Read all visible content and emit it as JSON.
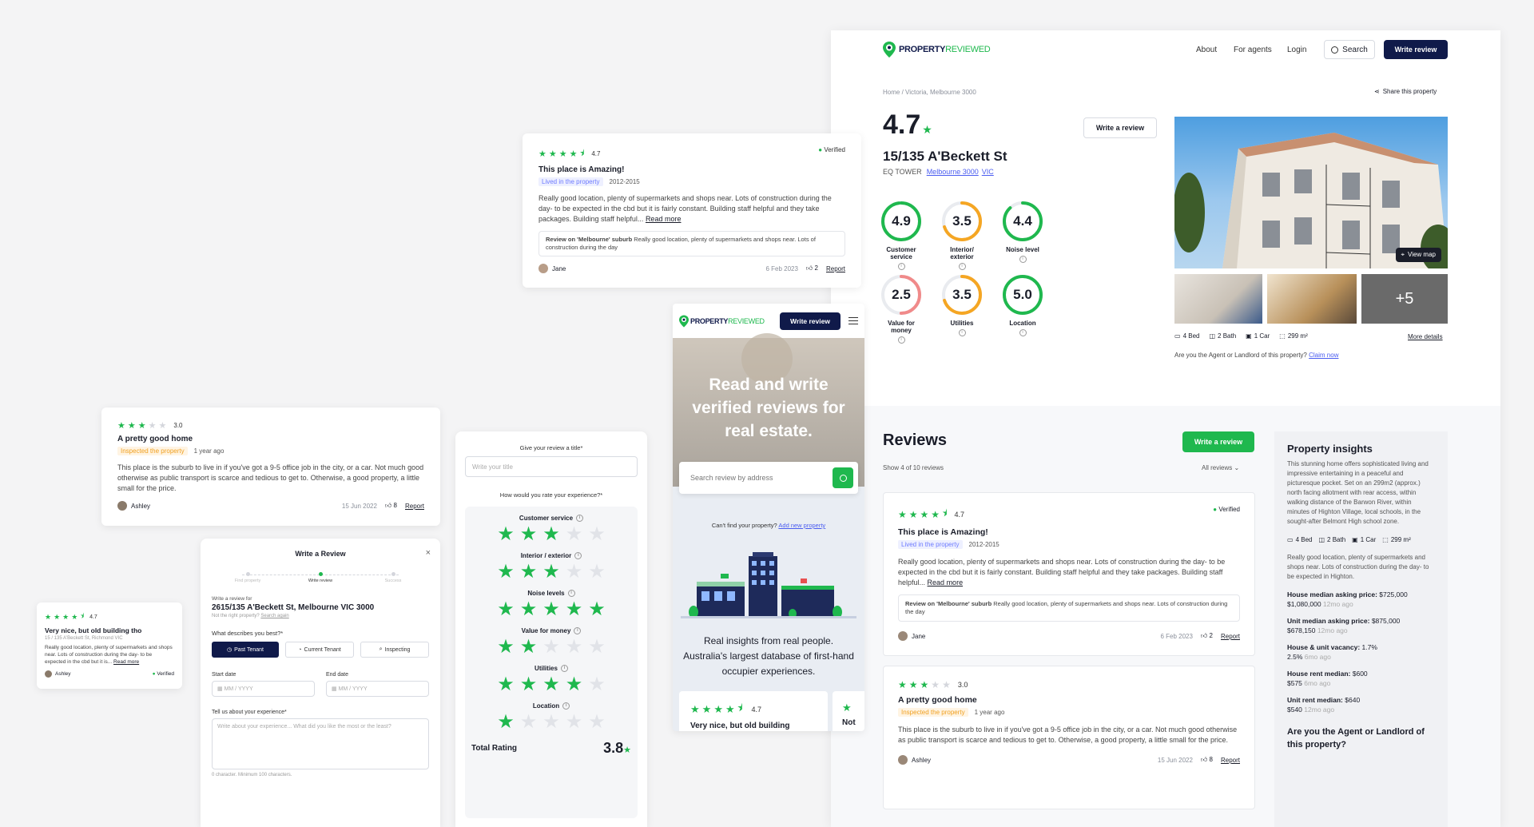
{
  "brand": {
    "name_a": "PROPERTY",
    "name_b": "REVIEWED",
    "green": "#1fb84e",
    "navy": "#101a4a"
  },
  "nav": {
    "about": "About",
    "agents": "For agents",
    "login": "Login",
    "search": "Search",
    "write": "Write review"
  },
  "page": {
    "breadcrumb": "Home / Victoria, Melbourne 3000",
    "share": "Share this property",
    "rating": "4.7",
    "address": "15/135 A'Beckett St",
    "building": "EQ TOWER",
    "suburb": "Melbourne 3000",
    "state": "VIC",
    "write_btn": "Write a review",
    "view_map": "View map",
    "more_photos": "+5",
    "features": [
      {
        "icon": "bed-icon",
        "label": "4 Bed"
      },
      {
        "icon": "bath-icon",
        "label": "2 Bath"
      },
      {
        "icon": "car-icon",
        "label": "1 Car"
      },
      {
        "icon": "area-icon",
        "label": "299 m²"
      }
    ],
    "more_details": "More details",
    "claim_q": "Are you the Agent or Landlord of this property?",
    "claim_link": "Claim now",
    "scores": [
      {
        "value": "4.9",
        "pct": 0.98,
        "label": "Customer service",
        "color": "#1fb84e"
      },
      {
        "value": "3.5",
        "pct": 0.7,
        "label": "Interior/ exterior",
        "color": "#f5a623"
      },
      {
        "value": "4.4",
        "pct": 0.88,
        "label": "Noise level",
        "color": "#1fb84e"
      },
      {
        "value": "2.5",
        "pct": 0.5,
        "label": "Value for money",
        "color": "#f08a8a"
      },
      {
        "value": "3.5",
        "pct": 0.7,
        "label": "Utilities",
        "color": "#f5a623"
      },
      {
        "value": "5.0",
        "pct": 1.0,
        "label": "Location",
        "color": "#1fb84e"
      }
    ]
  },
  "reviews": {
    "title": "Reviews",
    "count": "Show 4 of 10 reviews",
    "filter": "All reviews",
    "write": "Write a review",
    "items": [
      {
        "rating": "4.7",
        "stars": 4.5,
        "verified": "Verified",
        "title": "This place is Amazing!",
        "tag": "Lived in the property",
        "years": "2012-2015",
        "text": "Really good location, plenty of supermarkets and shops near. Lots of construction during the day- to be expected in the cbd but it is fairly constant. Building staff helpful and they take packages. Building staff helpful...",
        "more": "Read more",
        "quote_head": "Review on 'Melbourne' suburb",
        "quote": "Really good location, plenty of supermarkets and shops near. Lots of construction during the day",
        "author": "Jane",
        "date": "6 Feb 2023",
        "likes": "2",
        "report": "Report"
      },
      {
        "rating": "3.0",
        "stars": 3,
        "title": "A pretty good home",
        "tag": "Inspected the property",
        "years": "1 year ago",
        "text": "This place is the suburb to live in if you've got a 9-5 office job in the city, or a car. Not much good otherwise as public transport is scarce and tedious to get to. Otherwise, a good property, a little small for the price.",
        "author": "Ashley",
        "date": "15 Jun 2022",
        "likes": "8",
        "report": "Report"
      }
    ]
  },
  "insights": {
    "title": "Property insights",
    "text": "This stunning home offers sophisticated living and impressive entertaining in a peaceful and picturesque pocket. Set on an 299m2 (approx.) north facing allotment with rear access, within walking distance of the Barwon River, within minutes of Highton Village, local schools, in the sought-after Belmont High school zone.",
    "features": [
      "4 Bed",
      "2 Bath",
      "1 Car",
      "299 m²"
    ],
    "text2": "Really good location, plenty of supermarkets and shops near. Lots of construction during the day- to be expected in Highton.",
    "stats": [
      {
        "label": "House median asking price:",
        "value": "$725,000",
        "prev": "$1,080,000",
        "ago": "12mo ago"
      },
      {
        "label": "Unit median asking price:",
        "value": "$875,000",
        "prev": "$678,150",
        "ago": "12mo ago"
      },
      {
        "label": "House & unit vacancy:",
        "value": "1.7%",
        "prev": "2.5%",
        "ago": "6mo ago"
      },
      {
        "label": "House rent median:",
        "value": "$600",
        "prev": "$575",
        "ago": "6mo ago"
      },
      {
        "label": "Unit rent median:",
        "value": "$640",
        "prev": "$540",
        "ago": "12mo ago"
      }
    ],
    "claim": "Are you the Agent or Landlord of this property?"
  },
  "mobile": {
    "write": "Write review",
    "hero": "Read and write verified reviews for real estate.",
    "search_ph": "Search review by address",
    "cant_find": "Can't find your property?",
    "add_new": "Add new property",
    "tagline": "Real insights from real people. Australia's largest database of first-hand occupier experiences.",
    "card_rating": "4.7",
    "card_title": "Very nice, but old building",
    "card2": "Not"
  },
  "small_card": {
    "rating": "4.7",
    "title": "Very nice, but old building tho",
    "address": "15 / 135 A'Beckett St, Richmond VIC",
    "text": "Really good location, plenty of supermarkets and shops near. Lots of construction during the day- to be expected in the cbd but it is...",
    "more": "Read more",
    "author": "Ashley",
    "verified": "Verified"
  },
  "form": {
    "title": "Write a Review",
    "steps": [
      "Find property",
      "Write review",
      "Success"
    ],
    "for_label": "Write a review for",
    "address": "2615/135 A'Beckett St, Melbourne VIC 3000",
    "not_right": "Not the right property?",
    "search_again": "Search again",
    "describes": "What describes you best?*",
    "roles": [
      "Past Tenant",
      "Current Tenant",
      "Inspecting"
    ],
    "start": "Start date",
    "end": "End date",
    "date_ph": "MM / YYYY",
    "tell": "Tell us about your experience*",
    "tell_ph": "Write about your experience... What did you like the most or the least?",
    "chars": "0 character. Minimum 100 characters."
  },
  "rate": {
    "title_label": "Give your review a title*",
    "title_ph": "Write your title",
    "how": "How would you rate your experience?*",
    "cats": [
      {
        "label": "Customer service",
        "n": 3
      },
      {
        "label": "Interior / exterior",
        "n": 3
      },
      {
        "label": "Noise levels",
        "n": 5
      },
      {
        "label": "Value for money",
        "n": 2
      },
      {
        "label": "Utilities",
        "n": 4
      },
      {
        "label": "Location",
        "n": 1
      }
    ],
    "total_label": "Total Rating",
    "total": "3.8"
  }
}
